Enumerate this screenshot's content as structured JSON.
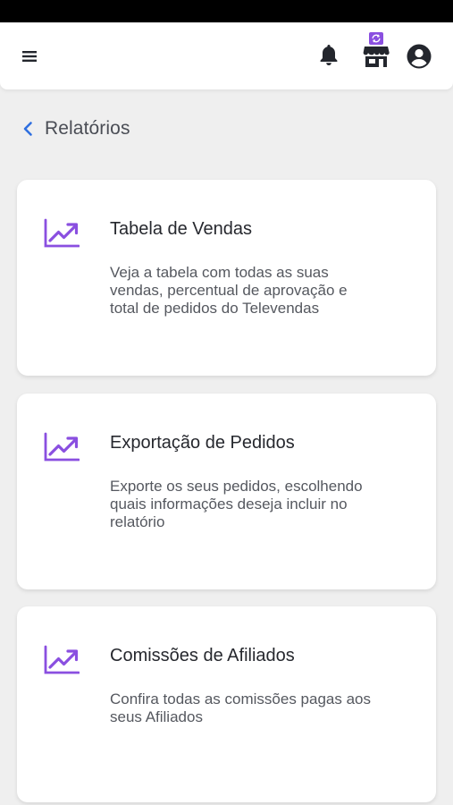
{
  "header": {
    "icons": {
      "menu": "hamburger-menu-icon",
      "notifications": "bell-icon",
      "store": "store-icon",
      "account": "account-circle-icon"
    },
    "accent_color": "#8a4fe0"
  },
  "breadcrumb": {
    "back_icon": "chevron-left-icon",
    "title": "Relatórios",
    "back_color": "#2f6fe0"
  },
  "reports": [
    {
      "icon": "trending-up-chart-icon",
      "title": "Tabela de Vendas",
      "description": "Veja a tabela com todas as suas vendas, percentual de aprovação e total de pedidos do Televendas"
    },
    {
      "icon": "trending-up-chart-icon",
      "title": "Exportação de Pedidos",
      "description": "Exporte os seus pedidos, escolhendo quais informações deseja incluir no relatório"
    },
    {
      "icon": "trending-up-chart-icon",
      "title": "Comissões de Afiliados",
      "description": "Confira todas as comissões pagas aos seus Afiliados"
    }
  ]
}
